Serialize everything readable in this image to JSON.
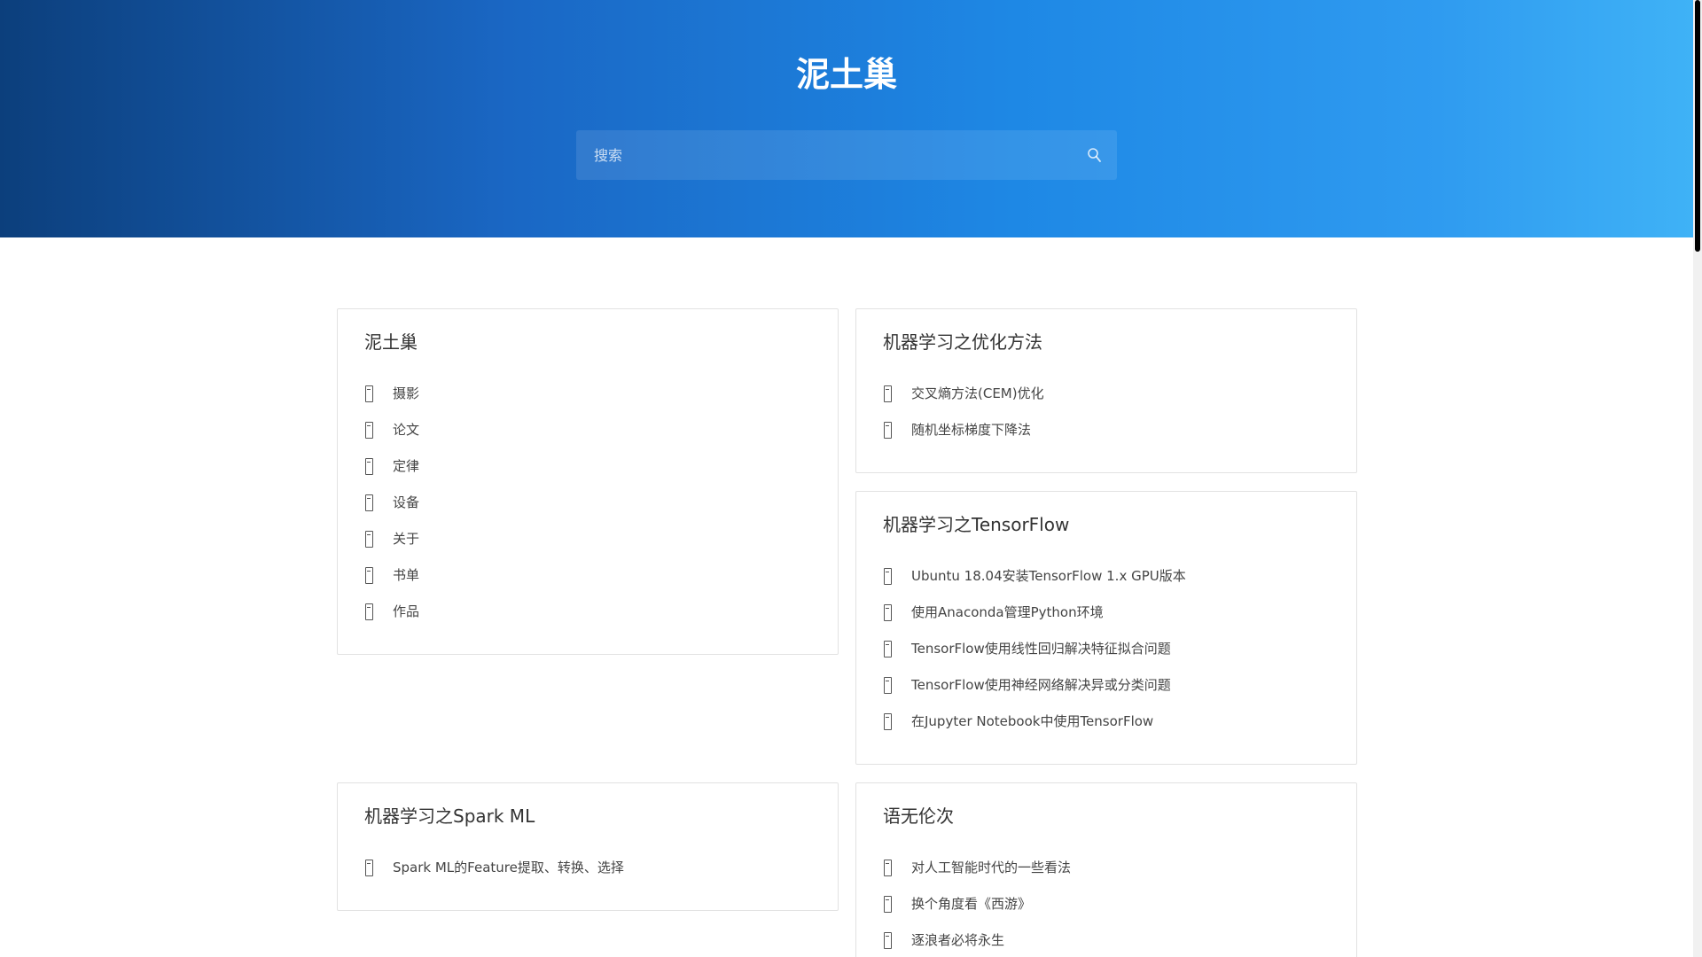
{
  "site": {
    "title": "泥土巢"
  },
  "search": {
    "placeholder": "搜索"
  },
  "icons": {
    "search": "search-icon",
    "item": "file-icon"
  },
  "colors": {
    "header_gradient_start": "#0c3f7c",
    "header_gradient_end": "#3fb2f6"
  },
  "sections": [
    {
      "title": "泥土巢",
      "items": [
        "摄影",
        "论文",
        "定律",
        "设备",
        "关于",
        "书单",
        "作品"
      ]
    },
    {
      "title": "机器学习之优化方法",
      "items": [
        "交叉熵方法(CEM)优化",
        "随机坐标梯度下降法"
      ]
    },
    {
      "title": "机器学习之TensorFlow",
      "items": [
        "Ubuntu 18.04安装TensorFlow 1.x GPU版本",
        "使用Anaconda管理Python环境",
        "TensorFlow使用线性回归解决特征拟合问题",
        "TensorFlow使用神经网络解决异或分类问题",
        "在Jupyter Notebook中使用TensorFlow"
      ]
    },
    {
      "title": "机器学习之Spark ML",
      "items": [
        "Spark ML的Feature提取、转换、选择"
      ]
    },
    {
      "title": "语无伦次",
      "items": [
        "对人工智能时代的一些看法",
        "换个角度看《西游》",
        "逐浪者必将永生"
      ]
    }
  ]
}
